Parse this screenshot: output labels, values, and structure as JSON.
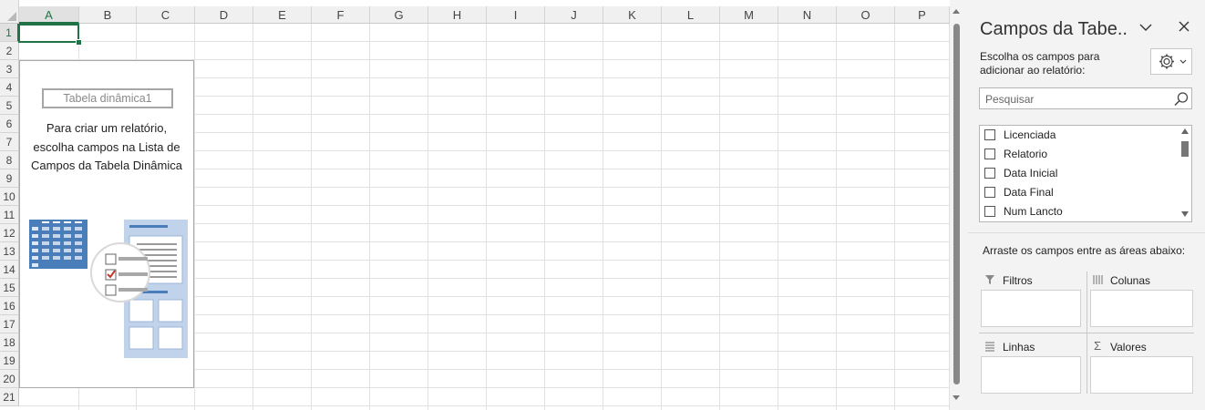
{
  "sheet": {
    "columns": [
      "A",
      "B",
      "C",
      "D",
      "E",
      "F",
      "G",
      "H",
      "I",
      "J",
      "K",
      "L",
      "M",
      "N",
      "O",
      "P"
    ],
    "rows": [
      "1",
      "2",
      "3",
      "4",
      "5",
      "6",
      "7",
      "8",
      "9",
      "10",
      "11",
      "12",
      "13",
      "14",
      "15",
      "16",
      "17",
      "18",
      "19",
      "20",
      "21"
    ],
    "selected_cell": "A1",
    "accent_color": "#217346"
  },
  "pivot": {
    "name": "Tabela dinâmica1",
    "instructions_line1": "Para criar um relatório,",
    "instructions_line2": "escolha campos na Lista de",
    "instructions_line3": "Campos da Tabela Dinâmica"
  },
  "pane": {
    "title": "Campos da Tabe..",
    "dropdown_icon": "chevron-down-icon",
    "close_icon": "close-icon",
    "choose_line1": "Escolha os campos para",
    "choose_line2": "adicionar ao relatório:",
    "tools_icon": "gear-icon",
    "search_placeholder": "Pesquisar",
    "fields": [
      "Licenciada",
      "Relatorio",
      "Data Inicial",
      "Data Final",
      "Num Lancto"
    ],
    "drag_label": "Arraste os campos entre as áreas abaixo:",
    "areas": {
      "filters": "Filtros",
      "columns": "Colunas",
      "rows": "Linhas",
      "values": "Valores"
    }
  }
}
